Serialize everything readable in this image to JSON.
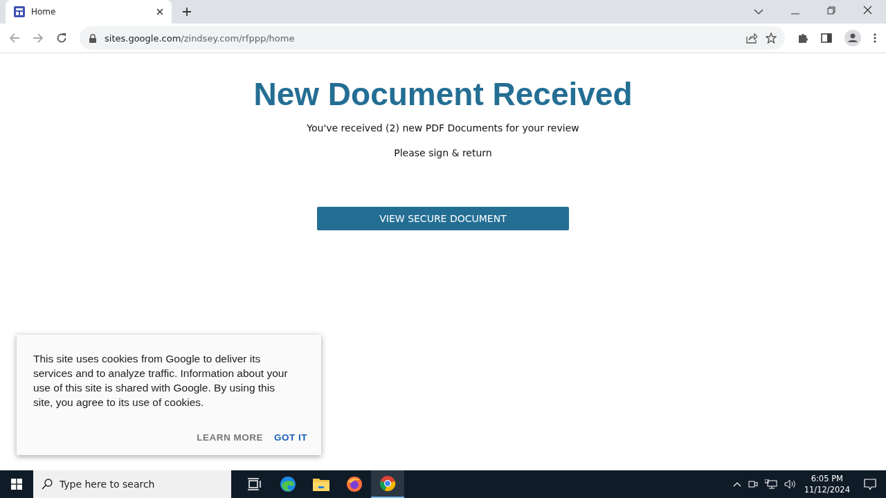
{
  "browser": {
    "tabs": [
      {
        "title": "Home",
        "selected": true
      }
    ],
    "url": {
      "host": "sites.google.com",
      "path": "/zindsey.com/rfppp/home"
    }
  },
  "page": {
    "heading": "New Document Received",
    "lines": [
      "You've received (2) new PDF Documents for your review",
      "Please sign & return"
    ],
    "button": "VIEW SECURE DOCUMENT"
  },
  "cookie_notice": {
    "text": "This site uses cookies from Google to deliver its services and to analyze traffic. Information about your use of this site is shared with Google. By using this site, you agree to its use of cookies.",
    "buttons": [
      {
        "label": "LEARN MORE",
        "kind": "secondary"
      },
      {
        "label": "GOT IT",
        "kind": "primary"
      }
    ]
  },
  "taskbar": {
    "search": {
      "placeholder": "Type here to search"
    },
    "apps": [
      {
        "kind": "taskview",
        "selected": false
      },
      {
        "kind": "edge",
        "selected": false
      },
      {
        "kind": "files",
        "selected": false
      },
      {
        "kind": "firefox",
        "selected": false
      },
      {
        "kind": "chrome",
        "selected": true
      }
    ],
    "time": "6:05 PM",
    "date": "11/12/2024"
  }
}
